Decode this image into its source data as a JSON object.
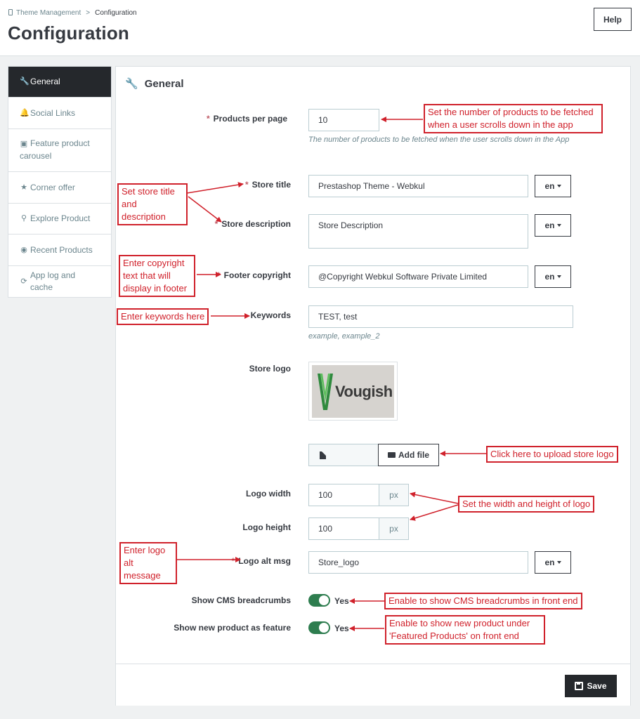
{
  "header": {
    "breadcrumb_parent": "Theme Management",
    "breadcrumb_separator": ">",
    "breadcrumb_current": "Configuration",
    "title": "Configuration",
    "help_label": "Help"
  },
  "sidebar": {
    "items": [
      {
        "label": "General",
        "icon": "wrench-icon",
        "active": true
      },
      {
        "label": "Social Links",
        "icon": "bell-icon",
        "active": false
      },
      {
        "label": "Feature product carousel",
        "icon": "archive-icon",
        "active": false
      },
      {
        "label": "Corner offer",
        "icon": "star-icon",
        "active": false
      },
      {
        "label": "Explore Product",
        "icon": "search-icon",
        "active": false
      },
      {
        "label": "Recent Products",
        "icon": "eye-icon",
        "active": false
      },
      {
        "label": "App log and cache",
        "icon": "refresh-icon",
        "active": false
      }
    ]
  },
  "panel": {
    "heading": "General",
    "required_mark": "*",
    "products_per_page": {
      "label": "Products per page",
      "value": "10",
      "hint": "The number of products to be fetched when the user scrolls down in the App"
    },
    "store_title": {
      "label": "Store title",
      "value": "Prestashop Theme - Webkul",
      "lang": "en"
    },
    "store_description": {
      "label": "Store description",
      "value": "Store Description",
      "lang": "en"
    },
    "footer_copyright": {
      "label": "Footer copyright",
      "value": "@Copyright Webkul Software Private Limited",
      "lang": "en"
    },
    "keywords": {
      "label": "Keywords",
      "value": "TEST, test",
      "hint": "example, example_2"
    },
    "store_logo": {
      "label": "Store logo",
      "logo_text": "Vougish",
      "add_file_label": "Add file"
    },
    "logo_width": {
      "label": "Logo width",
      "value": "100",
      "unit": "px"
    },
    "logo_height": {
      "label": "Logo height",
      "value": "100",
      "unit": "px"
    },
    "logo_alt": {
      "label": "Logo alt msg",
      "value": "Store_logo",
      "lang": "en"
    },
    "cms_breadcrumbs": {
      "label": "Show CMS breadcrumbs",
      "state": "Yes",
      "enabled": true
    },
    "new_product_feature": {
      "label": "Show new product as feature",
      "state": "Yes",
      "enabled": true
    },
    "save_label": "Save"
  },
  "annotations": {
    "products_per_page": "Set the number of products to be fetched when a user scrolls down in the app",
    "store_title_desc": "Set store title and description",
    "copyright": "Enter copyright text that will display in footer",
    "keywords": "Enter keywords here",
    "upload_logo": "Click here to upload store logo",
    "logo_size": "Set the width and height of logo",
    "logo_alt": "Enter logo alt message",
    "cms_breadcrumbs": "Enable to show CMS breadcrumbs in front end",
    "new_product": "Enable to show new product under 'Featured Products' on front end"
  },
  "colors": {
    "accent_dark": "#25282c",
    "annotation_red": "#d0212b",
    "toggle_green": "#2e7d4f",
    "required_mark": "#c05c67"
  }
}
